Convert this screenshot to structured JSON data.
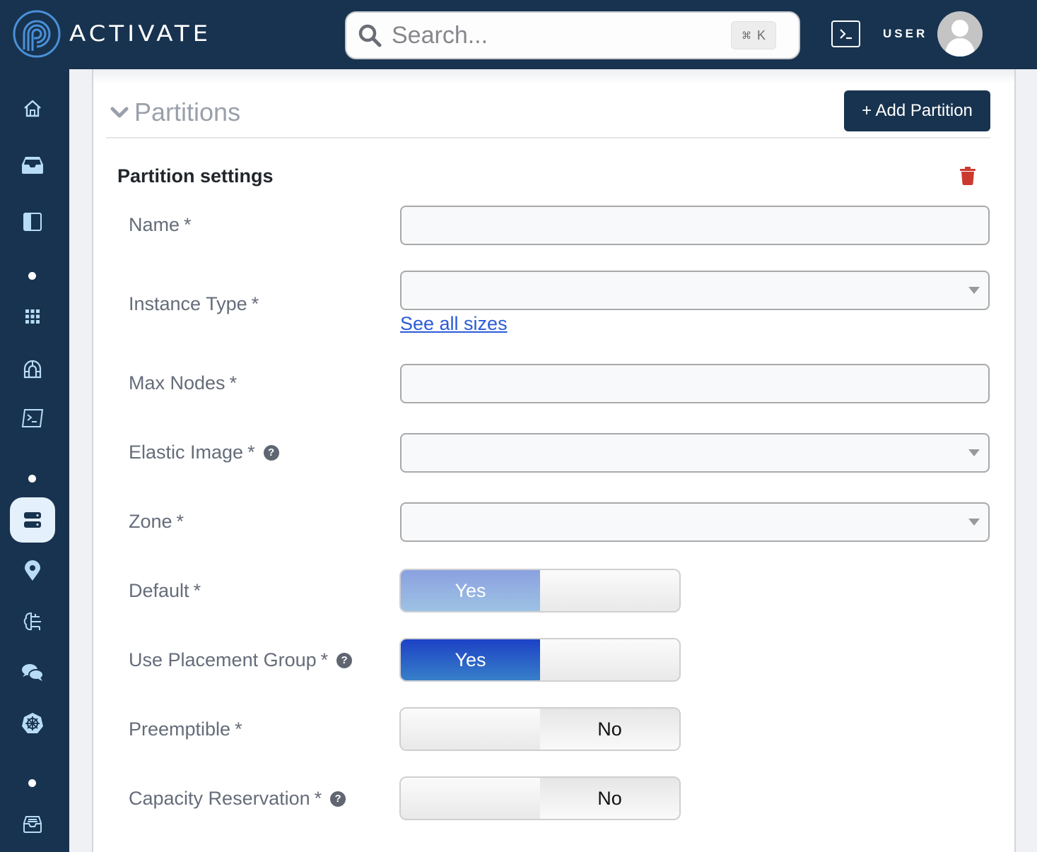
{
  "app": {
    "brand": "ACTIVATE",
    "brand_color": "#18334f",
    "accent_color": "#4a90d9"
  },
  "topbar": {
    "search": {
      "placeholder": "Search...",
      "value": "",
      "shortcut_symbol": "⌘",
      "shortcut_key": "K",
      "icon": "search-icon"
    },
    "terminal_icon": "terminal-icon",
    "user_label": "USER",
    "avatar_icon": "user-avatar-icon"
  },
  "sidebar": {
    "items": [
      {
        "name": "home",
        "icon": "home-icon",
        "active": false
      },
      {
        "name": "inbox",
        "icon": "inbox-icon",
        "active": false
      },
      {
        "name": "panels",
        "icon": "sidebar-panel-icon",
        "active": false
      },
      {
        "name": "apps",
        "icon": "grid-icon",
        "active": false
      },
      {
        "name": "tunnels",
        "icon": "tunnel-icon",
        "active": false
      },
      {
        "name": "terminal",
        "icon": "terminal-icon",
        "active": false
      },
      {
        "name": "clusters",
        "icon": "server-icon",
        "active": true
      },
      {
        "name": "locations",
        "icon": "map-pin-icon",
        "active": false
      },
      {
        "name": "ai",
        "icon": "brain-circuit-icon",
        "active": false
      },
      {
        "name": "chat",
        "icon": "comments-icon",
        "active": false
      },
      {
        "name": "kubernetes",
        "icon": "kubernetes-icon",
        "active": false
      },
      {
        "name": "storage",
        "icon": "archive-tray-icon",
        "active": false
      }
    ]
  },
  "section": {
    "title": "Partitions",
    "collapse_icon": "chevron-down-icon",
    "add_button": "+ Add Partition"
  },
  "partition": {
    "title": "Partition settings",
    "delete_icon": "trash-icon",
    "delete_color": "#cc3a2f",
    "fields": {
      "name": {
        "label": "Name",
        "required": "*",
        "value": ""
      },
      "instance_type": {
        "label": "Instance Type",
        "required": "*",
        "value": "",
        "link": "See all sizes"
      },
      "max_nodes": {
        "label": "Max Nodes",
        "required": "*",
        "value": ""
      },
      "elastic_image": {
        "label": "Elastic Image",
        "required": "*",
        "value": "",
        "help": "?"
      },
      "zone": {
        "label": "Zone",
        "required": "*",
        "value": ""
      },
      "default": {
        "label": "Default",
        "required": "*",
        "value": "Yes",
        "state": "disabled"
      },
      "use_placement_group": {
        "label": "Use Placement Group",
        "required": "*",
        "value": "Yes",
        "help": "?"
      },
      "preemptible": {
        "label": "Preemptible",
        "required": "*",
        "value": "No"
      },
      "capacity_reservation": {
        "label": "Capacity Reservation",
        "required": "*",
        "value": "No",
        "help": "?"
      }
    }
  }
}
